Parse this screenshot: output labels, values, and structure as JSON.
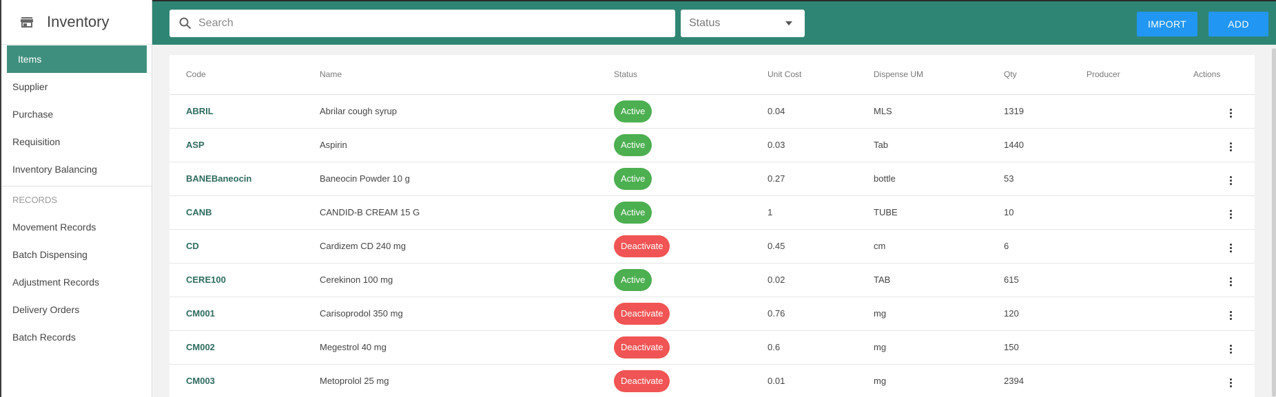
{
  "app": {
    "title": "Inventory"
  },
  "sidebar": {
    "items": [
      {
        "label": "Items",
        "active": true
      },
      {
        "label": "Supplier"
      },
      {
        "label": "Purchase"
      },
      {
        "label": "Requisition"
      },
      {
        "label": "Inventory Balancing"
      }
    ],
    "section_label": "RECORDS",
    "records": [
      {
        "label": "Movement Records"
      },
      {
        "label": "Batch Dispensing"
      },
      {
        "label": "Adjustment Records"
      },
      {
        "label": "Delivery Orders"
      },
      {
        "label": "Batch Records"
      }
    ]
  },
  "toolbar": {
    "search_placeholder": "Search",
    "status_placeholder": "Status",
    "import_label": "IMPORT",
    "add_label": "ADD"
  },
  "table": {
    "headers": [
      "Code",
      "Name",
      "Status",
      "Unit Cost",
      "Dispense UM",
      "Qty",
      "Producer",
      "Actions"
    ],
    "rows": [
      {
        "code": "ABRIL",
        "name": "Abrilar cough syrup",
        "status": "Active",
        "cost": "0.04",
        "um": "MLS",
        "qty": "1319",
        "producer": ""
      },
      {
        "code": "ASP",
        "name": "Aspirin",
        "status": "Active",
        "cost": "0.03",
        "um": "Tab",
        "qty": "1440",
        "producer": ""
      },
      {
        "code": "BANEBaneocin",
        "name": "Baneocin Powder 10 g",
        "status": "Active",
        "cost": "0.27",
        "um": "bottle",
        "qty": "53",
        "producer": ""
      },
      {
        "code": "CANB",
        "name": "CANDID-B CREAM 15 G",
        "status": "Active",
        "cost": "1",
        "um": "TUBE",
        "qty": "10",
        "producer": ""
      },
      {
        "code": "CD",
        "name": "Cardizem CD 240 mg",
        "status": "Deactivate",
        "cost": "0.45",
        "um": "cm",
        "qty": "6",
        "producer": ""
      },
      {
        "code": "CERE100",
        "name": "Cerekinon 100 mg",
        "status": "Active",
        "cost": "0.02",
        "um": "TAB",
        "qty": "615",
        "producer": ""
      },
      {
        "code": "CM001",
        "name": "Carisoprodol 350 mg",
        "status": "Deactivate",
        "cost": "0.76",
        "um": "mg",
        "qty": "120",
        "producer": ""
      },
      {
        "code": "CM002",
        "name": "Megestrol 40 mg",
        "status": "Deactivate",
        "cost": "0.6",
        "um": "mg",
        "qty": "150",
        "producer": ""
      },
      {
        "code": "CM003",
        "name": "Metoprolol 25 mg",
        "status": "Deactivate",
        "cost": "0.01",
        "um": "mg",
        "qty": "2394",
        "producer": ""
      }
    ]
  },
  "colors": {
    "header_bg": "#2f8574",
    "active_nav": "#3f8f7e",
    "button": "#2196f3",
    "active_badge": "#4caf50",
    "deactivate_badge": "#f15454"
  }
}
